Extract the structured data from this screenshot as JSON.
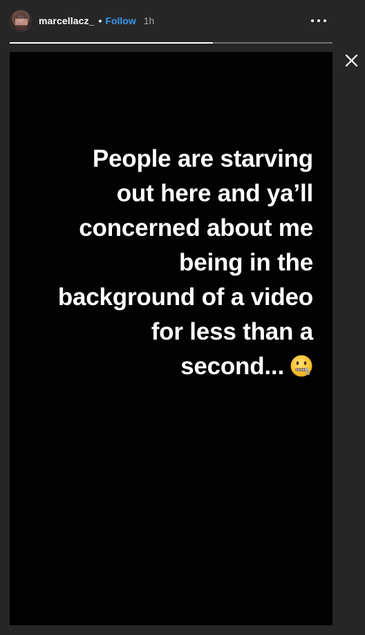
{
  "header": {
    "username": "marcellacz_",
    "separator": "•",
    "follow_label": "Follow",
    "time": "1h"
  },
  "progress": {
    "segments": 1,
    "fraction_viewed": 0.63
  },
  "icons": {
    "avatar": "profile-avatar",
    "more": "more-options-icon",
    "close": "close-icon",
    "emoji": "zipper-mouth-face-emoji"
  },
  "story": {
    "lines": [
      "People are starving",
      "out here and ya’ll",
      "concerned about me",
      "being in the",
      "background of a video",
      "for less than a",
      "second..."
    ]
  },
  "colors": {
    "background": "#262626",
    "story_background": "#020202",
    "follow": "#3897f0",
    "text": "#ffffff",
    "time": "#a8a8a8"
  }
}
